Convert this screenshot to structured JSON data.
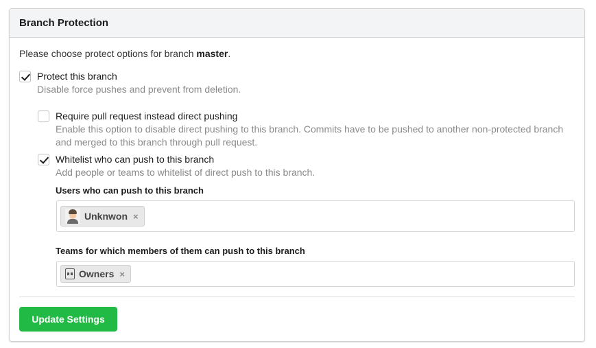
{
  "header": {
    "title": "Branch Protection"
  },
  "intro": {
    "text": "Please choose protect options for branch ",
    "branch": "master",
    "suffix": "."
  },
  "options": {
    "protect": {
      "label": "Protect this branch",
      "help": "Disable force pushes and prevent from deletion.",
      "checked": true
    },
    "require_pr": {
      "label": "Require pull request instead direct pushing",
      "help": "Enable this option to disable direct pushing to this branch. Commits have to be pushed to another non-protected branch and merged to this branch through pull request.",
      "checked": false
    },
    "whitelist": {
      "label": "Whitelist who can push to this branch",
      "help": "Add people or teams to whitelist of direct push to this branch.",
      "checked": true
    }
  },
  "users_field": {
    "label": "Users who can push to this branch",
    "chips": [
      {
        "name": "Unknwon",
        "icon": "user-avatar-icon",
        "remove": "×"
      }
    ]
  },
  "teams_field": {
    "label": "Teams for which members of them can push to this branch",
    "chips": [
      {
        "name": "Owners",
        "icon": "team-icon",
        "remove": "×"
      }
    ]
  },
  "actions": {
    "update_label": "Update Settings"
  },
  "colors": {
    "primary": "#21ba45",
    "header_bg": "#f3f4f5",
    "help_text": "#8a8a8a"
  }
}
